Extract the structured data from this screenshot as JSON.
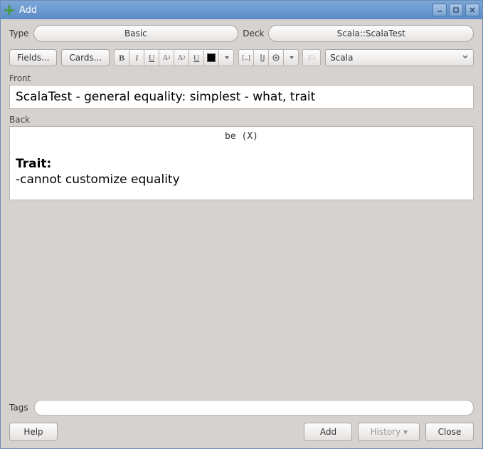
{
  "titlebar": {
    "title": "Add"
  },
  "selectors": {
    "type_label": "Type",
    "type_value": "Basic",
    "deck_label": "Deck",
    "deck_value": "Scala::ScalaTest"
  },
  "toolbar": {
    "fields_label": "Fields...",
    "cards_label": "Cards...",
    "highlight_dropdown": "Scala"
  },
  "fields": {
    "front_label": "Front",
    "front_value": "ScalaTest - general equality: simplest - what, trait",
    "back_label": "Back",
    "back_mono": "be (X)",
    "back_bold": "Trait:",
    "back_line": "-cannot customize equality"
  },
  "tags": {
    "label": "Tags",
    "value": ""
  },
  "buttons": {
    "help": "Help",
    "add": "Add",
    "history": "History ▾",
    "close": "Close"
  }
}
